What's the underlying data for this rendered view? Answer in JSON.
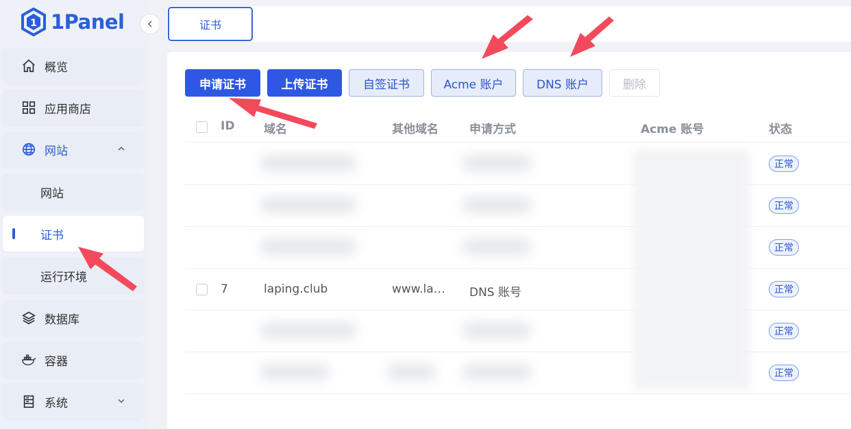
{
  "app": {
    "logo_text": "1Panel"
  },
  "sidebar": {
    "items": [
      {
        "label": "概览",
        "icon": "home-icon"
      },
      {
        "label": "应用商店",
        "icon": "grid-icon"
      },
      {
        "label": "网站",
        "icon": "globe-icon",
        "expanded": true
      },
      {
        "label": "网站",
        "sub": true
      },
      {
        "label": "证书",
        "sub": true,
        "active": true
      },
      {
        "label": "运行环境",
        "sub": true
      },
      {
        "label": "数据库",
        "icon": "layers-icon"
      },
      {
        "label": "容器",
        "icon": "docker-icon"
      },
      {
        "label": "系统",
        "icon": "server-icon",
        "expanded": false
      }
    ]
  },
  "tabs": [
    {
      "label": "证书",
      "active": true
    }
  ],
  "toolbar": {
    "apply_cert": "申请证书",
    "upload_cert": "上传证书",
    "self_signed": "自签证书",
    "acme_account": "Acme 账户",
    "dns_account": "DNS 账户",
    "delete": "删除"
  },
  "table": {
    "headers": {
      "id": "ID",
      "domain": "域名",
      "other_domains": "其他域名",
      "apply_method": "申请方式",
      "acme_account": "Acme 账号",
      "status": "状态"
    },
    "rows": [
      {
        "id": "",
        "domain": "",
        "other": "",
        "method": "",
        "status": "正常"
      },
      {
        "id": "",
        "domain": "",
        "other": "",
        "method": "",
        "status": "正常"
      },
      {
        "id": "",
        "domain": "",
        "other": "",
        "method": "",
        "status": "正常"
      },
      {
        "id": "7",
        "domain": "laping.club",
        "other": "www.la…",
        "method": "DNS 账号",
        "status": "正常"
      },
      {
        "id": "",
        "domain": "",
        "other": "",
        "method": "",
        "status": "正常"
      },
      {
        "id": "",
        "domain": "",
        "other": "",
        "method": "",
        "status": "正常"
      }
    ]
  },
  "colors": {
    "accent": "#2e58e2",
    "arrow": "#f24a5c"
  }
}
